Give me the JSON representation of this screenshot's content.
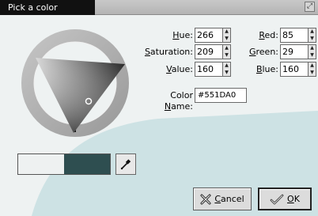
{
  "window": {
    "title": "Pick a color"
  },
  "hsv": {
    "hue_label": "Hue:",
    "hue_key": "H",
    "hue_rest": "ue:",
    "hue": "266",
    "sat_label": "Saturation:",
    "sat_key": "S",
    "sat_rest": "aturation:",
    "sat": "209",
    "val_label": "Value:",
    "val_key": "V",
    "val_rest": "alue:",
    "val": "160"
  },
  "rgb": {
    "red_label": "Red:",
    "red_key": "R",
    "red_rest": "ed:",
    "red": "85",
    "green_label": "Green:",
    "green_key": "G",
    "green_rest": "reen:",
    "green": "29",
    "blue_label": "Blue:",
    "blue_key": "B",
    "blue_rest": "lue:",
    "blue": "160"
  },
  "color_name": {
    "label_pre": "Color ",
    "label_key": "N",
    "label_rest": "ame:",
    "value": "#551DA0"
  },
  "buttons": {
    "cancel_key": "C",
    "cancel_rest": "ancel",
    "ok_key": "O",
    "ok_rest": "K"
  },
  "colors": {
    "previous": "#eef1f1",
    "current": "#2e4e50",
    "background_pale": "#eef2f2",
    "background_teal": "#cde2e4"
  },
  "icons": {
    "cancel": "x-mark-icon",
    "ok": "hand-check-icon",
    "eyedropper": "eyedropper-icon"
  }
}
